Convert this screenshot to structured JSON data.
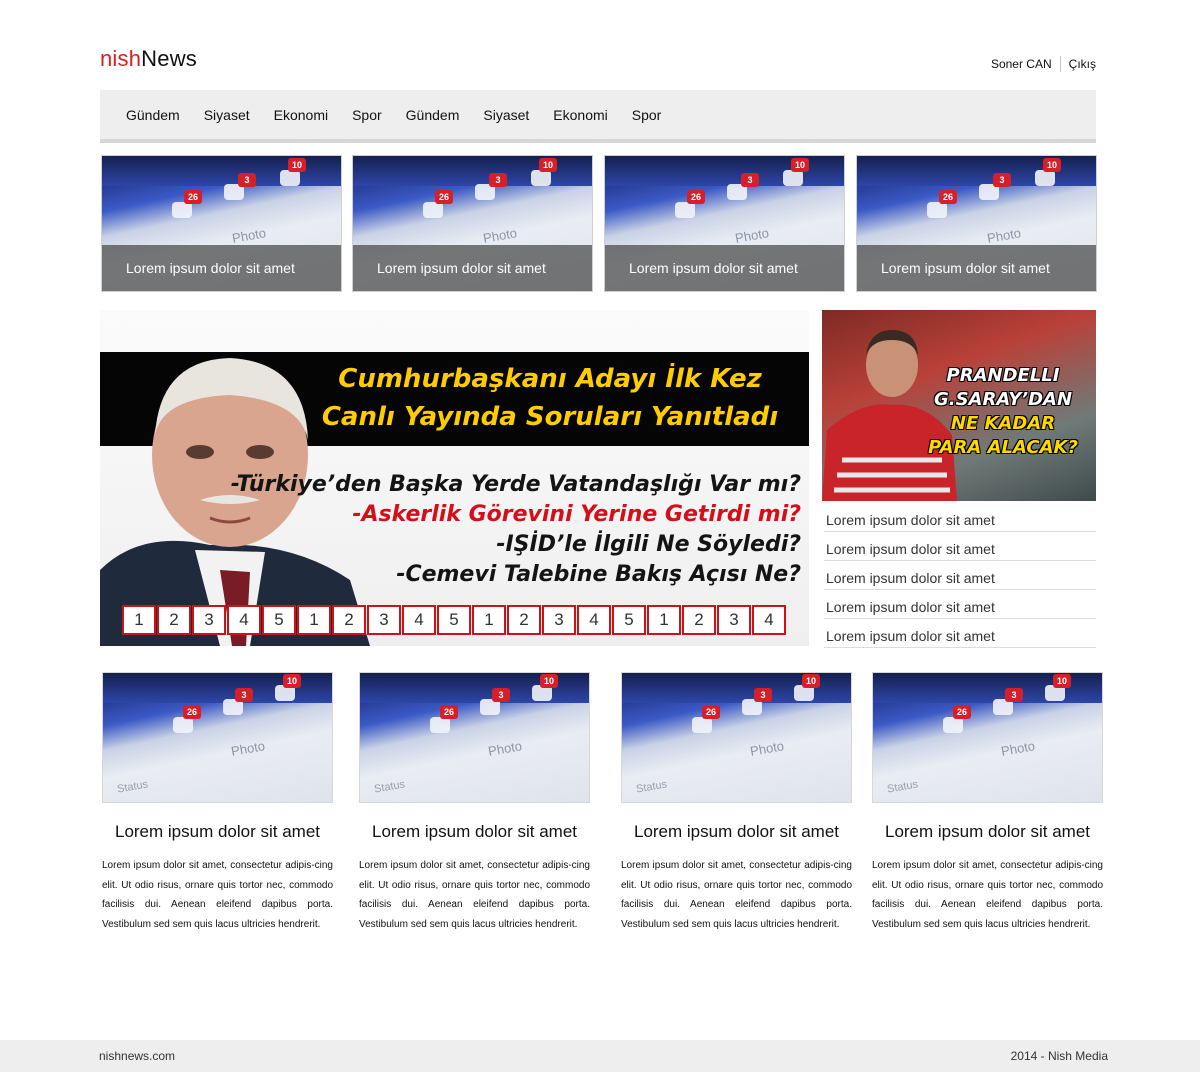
{
  "brand": {
    "part1": "nish",
    "part2": "News"
  },
  "user": {
    "name": "Soner CAN",
    "logout": "Çıkış"
  },
  "nav": [
    "Gündem",
    "Siyaset",
    "Ekonomi",
    "Spor",
    "Gündem",
    "Siyaset",
    "Ekonomi",
    "Spor"
  ],
  "thumb_badges": {
    "likes": "26",
    "messages": "3",
    "notifications": "10",
    "photo": "Photo",
    "status": "Status"
  },
  "top_thumbs": [
    {
      "caption": "Lorem ipsum dolor sit amet"
    },
    {
      "caption": "Lorem ipsum dolor sit amet"
    },
    {
      "caption": "Lorem ipsum dolor sit amet"
    },
    {
      "caption": "Lorem ipsum dolor sit amet"
    }
  ],
  "hero": {
    "headline1": "Cumhurbaşkanı Adayı İlk Kez",
    "headline2": "Canlı Yayında Soruları Yanıtladı",
    "bullets": [
      "-Türkiye’den Başka Yerde Vatandaşlığı Var mı?",
      "-Askerlik Görevini Yerine Getirdi mi?",
      "-IŞİD’le İlgili Ne Söyledi?",
      "-Cemevi Talebine Bakış Açısı Ne?"
    ],
    "pager": [
      "1",
      "2",
      "3",
      "4",
      "5",
      "1",
      "2",
      "3",
      "4",
      "5",
      "1",
      "2",
      "3",
      "4",
      "5",
      "1",
      "2",
      "3",
      "4"
    ]
  },
  "side": {
    "promo": [
      "PRANDELLI",
      "G.SARAY’DAN",
      "NE KADAR",
      "PARA ALACAK?"
    ],
    "links": [
      "Lorem ipsum dolor sit amet",
      "Lorem ipsum dolor sit amet",
      "Lorem ipsum dolor sit amet",
      "Lorem ipsum dolor sit amet",
      "Lorem ipsum dolor sit amet"
    ]
  },
  "cards": [
    {
      "title": "Lorem ipsum dolor sit amet",
      "body": "Lorem ipsum dolor sit amet, consectetur adipis-cing elit. Ut odio risus, ornare quis tortor nec, commodo facilisis dui. Aenean eleifend dapibus porta. Vestibulum sed sem quis lacus ultricies hendrerit."
    },
    {
      "title": "Lorem ipsum dolor sit amet",
      "body": "Lorem ipsum dolor sit amet, consectetur adipis-cing elit. Ut odio risus, ornare quis tortor nec, commodo facilisis dui. Aenean eleifend dapibus porta. Vestibulum sed sem quis lacus ultricies hendrerit."
    },
    {
      "title": "Lorem ipsum dolor sit amet",
      "body": "Lorem ipsum dolor sit amet, consectetur adipis-cing elit. Ut odio risus, ornare quis tortor nec, commodo facilisis dui. Aenean eleifend dapibus porta. Vestibulum sed sem quis lacus ultricies hendrerit."
    },
    {
      "title": "Lorem ipsum dolor sit amet",
      "body": "Lorem ipsum dolor sit amet, consectetur adipis-cing elit. Ut odio risus, ornare quis tortor nec, commodo facilisis dui. Aenean eleifend dapibus porta. Vestibulum sed sem quis lacus ultricies hendrerit."
    }
  ],
  "footer": {
    "site": "nishnews.com",
    "copyright": "2014 - Nish Media"
  }
}
